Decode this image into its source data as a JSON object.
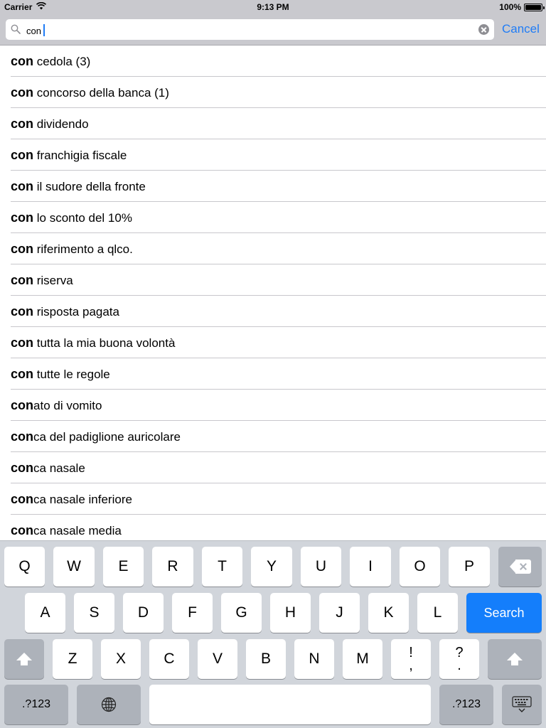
{
  "status_bar": {
    "carrier": "Carrier",
    "time": "9:13 PM",
    "battery": "100%"
  },
  "search": {
    "query": "con",
    "cancel_label": "Cancel"
  },
  "results": [
    {
      "match": "con",
      "rest": " cedola (3)"
    },
    {
      "match": "con",
      "rest": " concorso della banca (1)"
    },
    {
      "match": "con",
      "rest": " dividendo"
    },
    {
      "match": "con",
      "rest": " franchigia fiscale"
    },
    {
      "match": "con",
      "rest": " il sudore della fronte"
    },
    {
      "match": "con",
      "rest": " lo sconto del 10%"
    },
    {
      "match": "con",
      "rest": " riferimento a qlco."
    },
    {
      "match": "con",
      "rest": " riserva"
    },
    {
      "match": "con",
      "rest": " risposta pagata"
    },
    {
      "match": "con",
      "rest": " tutta la mia buona volontà"
    },
    {
      "match": "con",
      "rest": " tutte le regole"
    },
    {
      "match": "con",
      "rest": "ato di vomito"
    },
    {
      "match": "con",
      "rest": "ca del padiglione auricolare"
    },
    {
      "match": "con",
      "rest": "ca nasale"
    },
    {
      "match": "con",
      "rest": "ca nasale inferiore"
    },
    {
      "match": "con",
      "rest": "ca nasale media"
    }
  ],
  "keyboard": {
    "row1": [
      "Q",
      "W",
      "E",
      "R",
      "T",
      "Y",
      "U",
      "I",
      "O",
      "P"
    ],
    "row2": [
      "A",
      "S",
      "D",
      "F",
      "G",
      "H",
      "J",
      "K",
      "L"
    ],
    "row3": [
      "Z",
      "X",
      "C",
      "V",
      "B",
      "N",
      "M"
    ],
    "punct1": [
      "!",
      ","
    ],
    "punct2": [
      "?",
      "."
    ],
    "search_label": "Search",
    "numbers_label": ".?123",
    "icons": {
      "delete": "backspace-icon",
      "shift": "shift-icon",
      "globe": "globe-icon",
      "hide": "keyboard-dismiss-icon"
    }
  }
}
